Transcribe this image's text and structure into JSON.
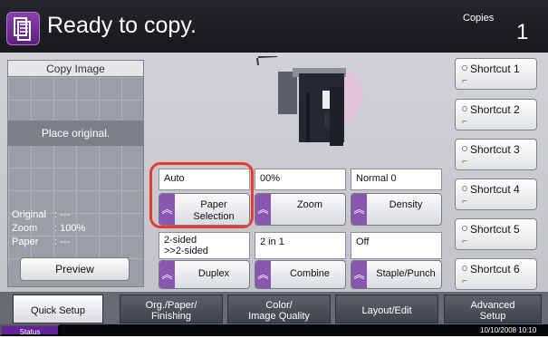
{
  "header": {
    "title": "Ready to copy.",
    "copies_label": "Copies",
    "copies_count": "1"
  },
  "preview": {
    "label": "Copy Image",
    "placeholder": "Place original.",
    "info": [
      {
        "key": "Original",
        "value": ": ---"
      },
      {
        "key": "Zoom",
        "value": ": 100%"
      },
      {
        "key": "Paper",
        "value": ": ---"
      }
    ],
    "button_label": "Preview"
  },
  "functions": {
    "paper_selection": {
      "value": "Auto",
      "label": "Paper\nSelection"
    },
    "zoom": {
      "value": "00%",
      "label": "Zoom"
    },
    "density": {
      "value": "Normal 0",
      "label": "Density"
    },
    "duplex": {
      "value": "2-sided\n>>2-sided",
      "label": "Duplex"
    },
    "combine": {
      "value": "2 in 1",
      "label": "Combine"
    },
    "staple_punch": {
      "value": "Off",
      "label": "Staple/Punch"
    }
  },
  "shortcuts": [
    "Shortcut 1",
    "Shortcut 2",
    "Shortcut 3",
    "Shortcut 4",
    "Shortcut 5",
    "Shortcut 6"
  ],
  "tabs": [
    "Quick Setup",
    "Org./Paper/\nFinishing",
    "Color/\nImage Quality",
    "Layout/Edit",
    "Advanced\nSetup"
  ],
  "status": {
    "button": "Status",
    "timestamp": "10/10/2008   10:10"
  },
  "colors": {
    "accent": "#6d3197",
    "highlight": "#e73b32"
  },
  "icons": {
    "header": "copy-icon",
    "shortcut": "shortcut-key-icon"
  }
}
